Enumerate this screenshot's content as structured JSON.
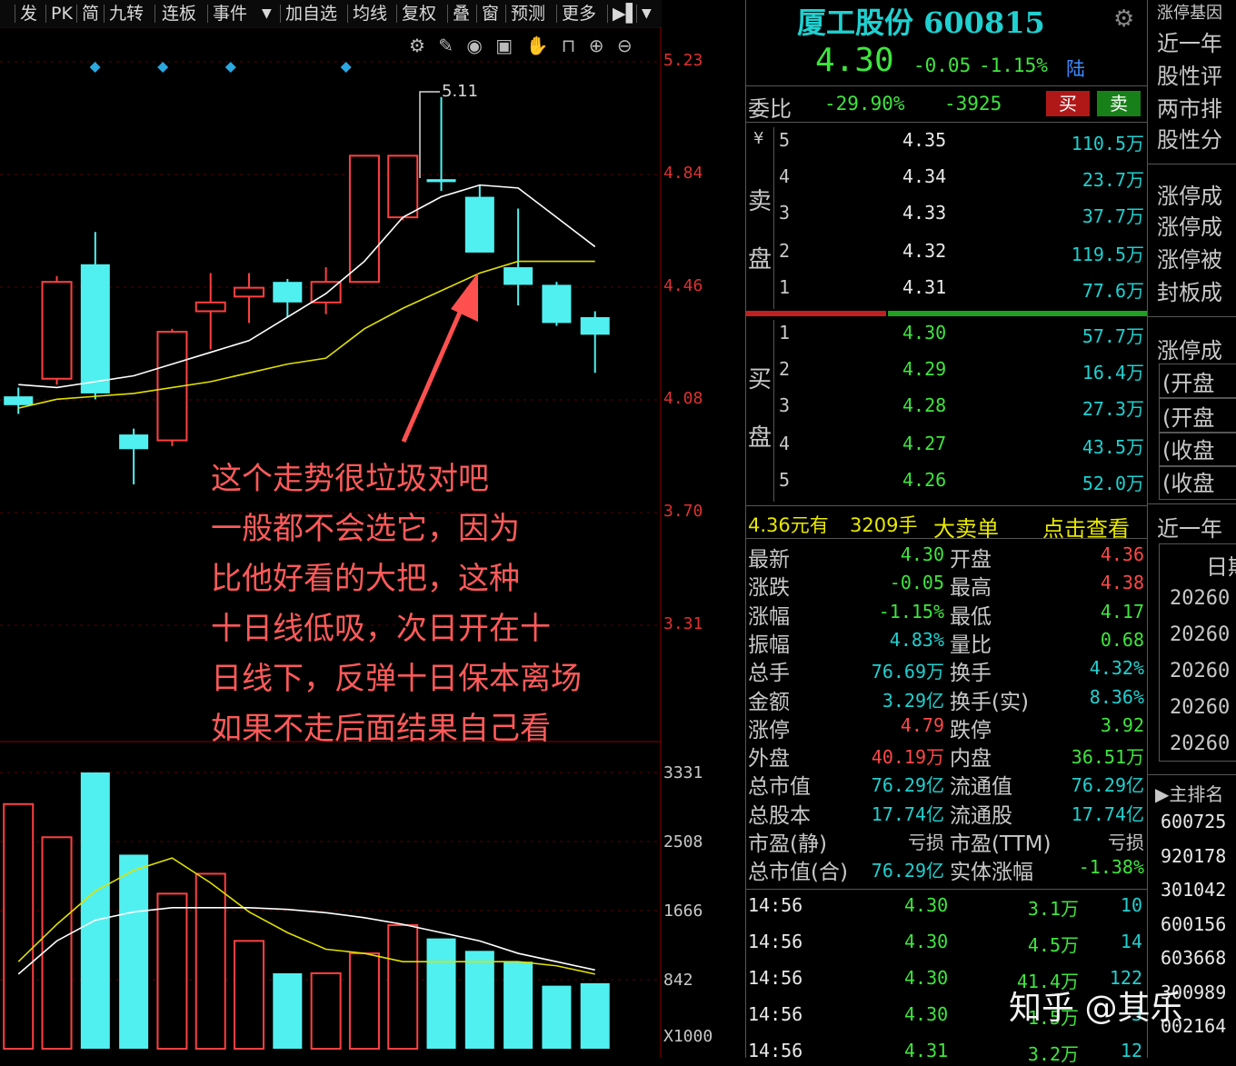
{
  "toolbar": {
    "items": [
      "发",
      "PK",
      "简",
      "九转",
      "连板",
      "事件",
      "加自选",
      "均线",
      "复权",
      "叠",
      "窗",
      "预测",
      "更多"
    ]
  },
  "chart": {
    "price_axis": [
      "5.23",
      "4.84",
      "4.46",
      "4.08",
      "3.70",
      "3.31"
    ],
    "volume_axis": [
      "3331",
      "2508",
      "1666",
      "842",
      "X1000"
    ],
    "high_marker": "5.11",
    "colors": {
      "up": "#ff4040",
      "down": "#50f0f0",
      "ma5": "#ffffff",
      "ma10": "#e0e000"
    },
    "candles": [
      {
        "o": 4.09,
        "c": 4.06,
        "h": 4.12,
        "l": 4.03,
        "dir": "down"
      },
      {
        "o": 4.15,
        "c": 4.48,
        "h": 4.5,
        "l": 4.13,
        "dir": "up"
      },
      {
        "o": 4.54,
        "c": 4.1,
        "h": 4.65,
        "l": 4.08,
        "dir": "down"
      },
      {
        "o": 3.96,
        "c": 3.91,
        "h": 3.98,
        "l": 3.79,
        "dir": "down"
      },
      {
        "o": 3.94,
        "c": 4.31,
        "h": 4.32,
        "l": 3.92,
        "dir": "up"
      },
      {
        "o": 4.38,
        "c": 4.41,
        "h": 4.51,
        "l": 4.25,
        "dir": "up"
      },
      {
        "o": 4.43,
        "c": 4.46,
        "h": 4.51,
        "l": 4.34,
        "dir": "up"
      },
      {
        "o": 4.48,
        "c": 4.41,
        "h": 4.49,
        "l": 4.36,
        "dir": "down"
      },
      {
        "o": 4.41,
        "c": 4.48,
        "h": 4.53,
        "l": 4.37,
        "dir": "up"
      },
      {
        "o": 4.48,
        "c": 4.91,
        "h": 4.91,
        "l": 4.48,
        "dir": "up"
      },
      {
        "o": 4.91,
        "c": 4.7,
        "h": 4.91,
        "l": 4.69,
        "dir": "up"
      },
      {
        "o": 4.83,
        "c": 4.82,
        "h": 5.11,
        "l": 4.79,
        "dir": "down"
      },
      {
        "o": 4.77,
        "c": 4.58,
        "h": 4.81,
        "l": 4.58,
        "dir": "down"
      },
      {
        "o": 4.53,
        "c": 4.47,
        "h": 4.73,
        "l": 4.4,
        "dir": "down"
      },
      {
        "o": 4.47,
        "c": 4.34,
        "h": 4.48,
        "l": 4.33,
        "dir": "down"
      },
      {
        "o": 4.36,
        "c": 4.3,
        "h": 4.38,
        "l": 4.17,
        "dir": "down"
      }
    ],
    "ma5": [
      4.13,
      4.12,
      4.14,
      4.16,
      4.2,
      4.24,
      4.28,
      4.36,
      4.44,
      4.55,
      4.7,
      4.77,
      4.81,
      4.8,
      4.7,
      4.6
    ],
    "ma10": [
      4.05,
      4.08,
      4.09,
      4.1,
      4.12,
      4.14,
      4.17,
      4.2,
      4.22,
      4.32,
      4.39,
      4.45,
      4.51,
      4.55,
      4.55,
      4.55
    ],
    "volumes": [
      {
        "v": 2950,
        "dir": "up"
      },
      {
        "v": 2550,
        "dir": "up"
      },
      {
        "v": 3331,
        "dir": "down"
      },
      {
        "v": 2340,
        "dir": "down"
      },
      {
        "v": 1870,
        "dir": "up"
      },
      {
        "v": 2110,
        "dir": "up"
      },
      {
        "v": 1300,
        "dir": "up"
      },
      {
        "v": 910,
        "dir": "down"
      },
      {
        "v": 910,
        "dir": "up"
      },
      {
        "v": 1150,
        "dir": "up"
      },
      {
        "v": 1490,
        "dir": "up"
      },
      {
        "v": 1330,
        "dir": "down"
      },
      {
        "v": 1180,
        "dir": "down"
      },
      {
        "v": 1050,
        "dir": "down"
      },
      {
        "v": 760,
        "dir": "down"
      },
      {
        "v": 790,
        "dir": "down"
      }
    ],
    "vol_ma5": [
      1050,
      1500,
      1900,
      2150,
      2300,
      2000,
      1650,
      1400,
      1200,
      1150,
      1050,
      1050,
      1050,
      1050,
      1000,
      900
    ],
    "vol_ma10": [
      900,
      1300,
      1550,
      1650,
      1700,
      1700,
      1700,
      1680,
      1640,
      1580,
      1500,
      1400,
      1300,
      1150,
      1050,
      950
    ]
  },
  "annotation": {
    "lines": [
      "这个走势很垃圾对吧",
      "一般都不会选它，因为",
      "比他好看的大把，这种",
      "十日线低吸，次日开在十",
      "日线下，反弹十日保本离场",
      "如果不走后面结果自己看"
    ]
  },
  "quote": {
    "name": "厦工股份 600815",
    "price": "4.30",
    "change": "-0.05",
    "change_pct": "-1.15%",
    "market": "陆",
    "weibi_label": "委比",
    "weibi_pct": "-29.90%",
    "weicha": "-3925",
    "buy_btn": "买",
    "sell_btn": "卖",
    "ask_label": "卖盘",
    "bid_label": "买盘",
    "currency": "¥",
    "asks": [
      {
        "lvl": "5",
        "price": "4.35",
        "vol": "110.5万"
      },
      {
        "lvl": "4",
        "price": "4.34",
        "vol": "23.7万"
      },
      {
        "lvl": "3",
        "price": "4.33",
        "vol": "37.7万"
      },
      {
        "lvl": "2",
        "price": "4.32",
        "vol": "119.5万"
      },
      {
        "lvl": "1",
        "price": "4.31",
        "vol": "77.6万"
      }
    ],
    "bids": [
      {
        "lvl": "1",
        "price": "4.30",
        "vol": "57.7万"
      },
      {
        "lvl": "2",
        "price": "4.29",
        "vol": "16.4万"
      },
      {
        "lvl": "3",
        "price": "4.28",
        "vol": "27.3万"
      },
      {
        "lvl": "4",
        "price": "4.27",
        "vol": "43.5万"
      },
      {
        "lvl": "5",
        "price": "4.26",
        "vol": "52.0万"
      }
    ],
    "big_order": {
      "price": "4.36元有",
      "qty": "3209手",
      "label": "大卖单",
      "link": "点击查看"
    },
    "stats": [
      {
        "l1": "最新",
        "v1": "4.30",
        "c1": "green",
        "l2": "开盘",
        "v2": "4.36",
        "c2": "red"
      },
      {
        "l1": "涨跌",
        "v1": "-0.05",
        "c1": "green",
        "l2": "最高",
        "v2": "4.38",
        "c2": "red"
      },
      {
        "l1": "涨幅",
        "v1": "-1.15%",
        "c1": "green",
        "l2": "最低",
        "v2": "4.17",
        "c2": "green"
      },
      {
        "l1": "振幅",
        "v1": "4.83%",
        "c1": "cyan",
        "l2": "量比",
        "v2": "0.68",
        "c2": "green"
      },
      {
        "l1": "总手",
        "v1": "76.69万",
        "c1": "cyan",
        "l2": "换手",
        "v2": "4.32%",
        "c2": "cyan"
      },
      {
        "l1": "金额",
        "v1": "3.29亿",
        "c1": "cyan",
        "l2": "换手(实)",
        "v2": "8.36%",
        "c2": "cyan"
      },
      {
        "l1": "涨停",
        "v1": "4.79",
        "c1": "red",
        "l2": "跌停",
        "v2": "3.92",
        "c2": "green"
      },
      {
        "l1": "外盘",
        "v1": "40.19万",
        "c1": "red",
        "l2": "内盘",
        "v2": "36.51万",
        "c2": "green"
      },
      {
        "l1": "总市值",
        "v1": "76.29亿",
        "c1": "cyan",
        "l2": "流通值",
        "v2": "76.29亿",
        "c2": "cyan"
      },
      {
        "l1": "总股本",
        "v1": "17.74亿",
        "c1": "cyan",
        "l2": "流通股",
        "v2": "17.74亿",
        "c2": "cyan"
      },
      {
        "l1": "市盈(静)",
        "v1": "亏损",
        "c1": "gray",
        "l2": "市盈(TTM)",
        "v2": "亏损",
        "c2": "gray"
      },
      {
        "l1": "总市值(合)",
        "v1": "76.29亿",
        "c1": "cyan",
        "l2": "实体涨幅",
        "v2": "-1.38%",
        "c2": "green"
      }
    ],
    "ticks": [
      {
        "time": "14:56",
        "price": "4.30",
        "vol": "3.1万",
        "n": "10"
      },
      {
        "time": "14:56",
        "price": "4.30",
        "vol": "4.5万",
        "n": "14"
      },
      {
        "time": "14:56",
        "price": "4.30",
        "vol": "41.4万",
        "n": "122"
      },
      {
        "time": "14:56",
        "price": "4.30",
        "vol": "1.5万",
        "n": "3"
      },
      {
        "time": "14:56",
        "price": "4.31",
        "vol": "3.2万",
        "n": "12"
      }
    ]
  },
  "side": {
    "top_items": [
      "涨停基因",
      "近一年",
      "股性评",
      "两市排",
      "股性分"
    ],
    "mid_items": [
      "涨停成",
      "涨停成",
      "涨停被",
      "封板成"
    ],
    "box_title": "涨停成",
    "box_items": [
      "(开盘",
      "(开盘",
      "(收盘",
      "(收盘"
    ],
    "year_label": "近一年",
    "date_header": "日期",
    "dates": [
      "20260",
      "20260",
      "20260",
      "20260",
      "20260"
    ],
    "rank_title": "主排名",
    "ranks": [
      "600725",
      "920178",
      "301042",
      "600156",
      "603668",
      "300989",
      "002164"
    ]
  },
  "watermark": "知乎 @其乐"
}
